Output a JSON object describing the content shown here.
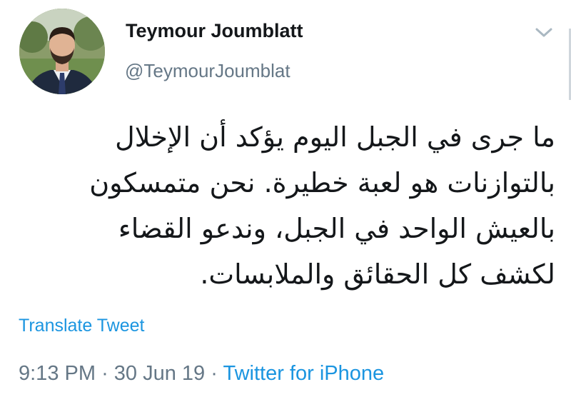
{
  "user": {
    "display_name": "Teymour Joumblatt",
    "handle": "@TeymourJoumblat"
  },
  "tweet": {
    "text_lines": [
      "ما جرى في الجبل اليوم يؤكد أن الإخلال",
      "بالتوازنات هو لعبة خطيرة. نحن متمسكون",
      "بالعيش الواحد في الجبل، وندعو القضاء",
      "لكشف كل الحقائق والملابسات."
    ],
    "translate_label": "Translate Tweet",
    "time": "9:13 PM",
    "separator": "·",
    "date": "30 Jun 19",
    "source": "Twitter for iPhone"
  },
  "icons": {
    "menu": "chevron-down-icon",
    "avatar": "profile-photo"
  },
  "colors": {
    "link": "#1b95e0",
    "secondary_text": "#657786",
    "primary_text": "#14171a",
    "background": "#ffffff"
  }
}
